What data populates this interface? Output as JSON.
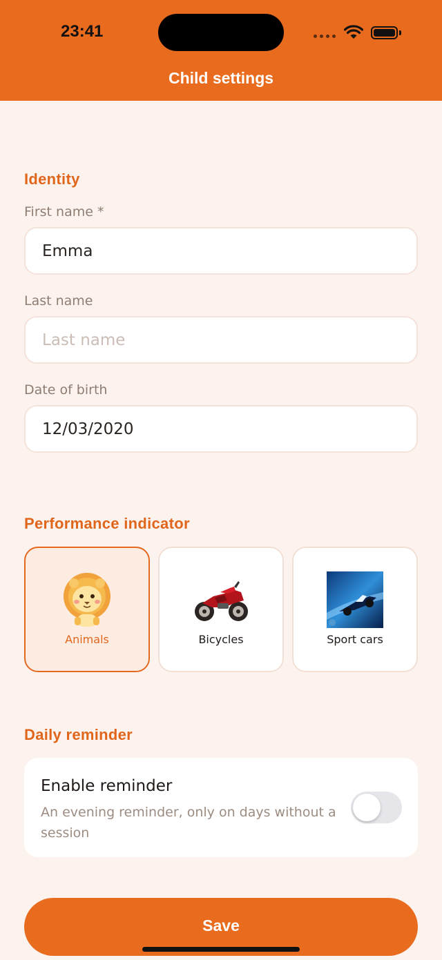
{
  "status_bar": {
    "time": "23:41"
  },
  "nav": {
    "title": "Child settings"
  },
  "identity": {
    "section_title": "Identity",
    "first_name": {
      "label": "First name *",
      "value": "Emma"
    },
    "last_name": {
      "label": "Last name",
      "placeholder": "Last name"
    },
    "date_of_birth": {
      "label": "Date of birth",
      "value": "12/03/2020"
    }
  },
  "performance": {
    "section_title": "Performance indicator",
    "options": [
      {
        "label": "Animals",
        "icon": "lion-icon",
        "selected": true
      },
      {
        "label": "Bicycles",
        "icon": "motorcycle-icon",
        "selected": false
      },
      {
        "label": "Sport cars",
        "icon": "race-car-icon",
        "selected": false
      }
    ]
  },
  "reminder": {
    "section_title": "Daily reminder",
    "title": "Enable reminder",
    "subtitle": "An evening reminder, only on days without a session",
    "enabled": false
  },
  "actions": {
    "save_label": "Save"
  },
  "colors": {
    "accent": "#e96b1e",
    "background": "#fdf3ee"
  }
}
